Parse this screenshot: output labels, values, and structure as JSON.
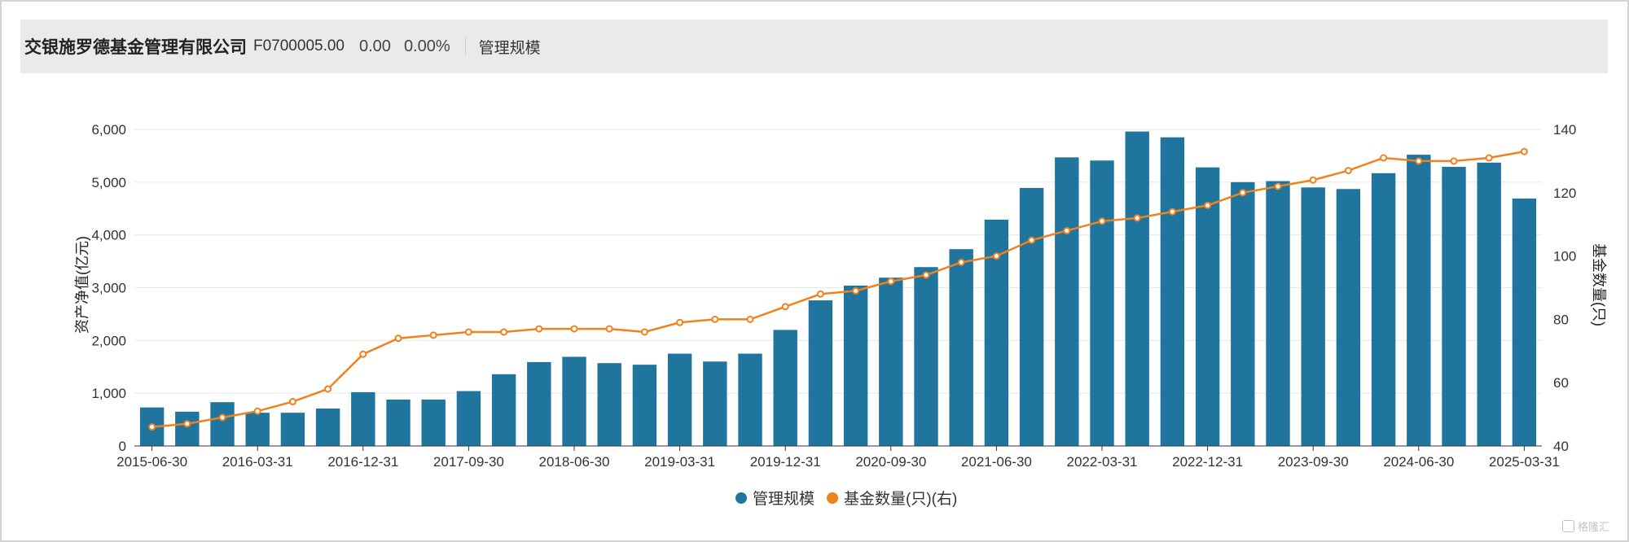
{
  "header": {
    "company": "交银施罗德基金管理有限公司",
    "code": "F0700005.00",
    "change": "0.00",
    "change_pct": "0.00%",
    "tab": "管理规模"
  },
  "watermark": "格隆汇",
  "colors": {
    "bar": "#20759f",
    "line": "#f0821e",
    "header_bg": "#e9eaec"
  },
  "chart_data": {
    "type": "bar",
    "categories": [
      "2015-06-30",
      "2015-09-30",
      "2015-12-31",
      "2016-03-31",
      "2016-06-30",
      "2016-09-30",
      "2016-12-31",
      "2017-03-31",
      "2017-06-30",
      "2017-09-30",
      "2017-12-31",
      "2018-03-31",
      "2018-06-30",
      "2018-09-30",
      "2018-12-31",
      "2019-03-31",
      "2019-06-30",
      "2019-09-30",
      "2019-12-31",
      "2020-03-31",
      "2020-06-30",
      "2020-09-30",
      "2020-12-31",
      "2021-03-31",
      "2021-06-30",
      "2021-09-30",
      "2021-12-31",
      "2022-03-31",
      "2022-06-30",
      "2022-09-30",
      "2022-12-31",
      "2023-03-31",
      "2023-06-30",
      "2023-09-30",
      "2023-12-31",
      "2024-03-31",
      "2024-06-30",
      "2024-09-30",
      "2024-12-31",
      "2025-03-31"
    ],
    "x_tick_labels": [
      "2015-06-30",
      "2016-03-31",
      "2016-12-31",
      "2017-09-30",
      "2018-06-30",
      "2019-03-31",
      "2019-12-31",
      "2020-09-30",
      "2021-06-30",
      "2022-03-31",
      "2022-12-31",
      "2023-09-30",
      "2024-06-30",
      "2025-03-31"
    ],
    "series": [
      {
        "name": "管理规模",
        "type": "bar",
        "axis": "left",
        "values": [
          730,
          650,
          830,
          630,
          630,
          710,
          1020,
          880,
          880,
          1040,
          1360,
          1590,
          1690,
          1570,
          1540,
          1750,
          1600,
          1750,
          2200,
          2760,
          3040,
          3190,
          3390,
          3730,
          4290,
          4890,
          5470,
          5410,
          5960,
          5850,
          5280,
          5000,
          5020,
          4900,
          4870,
          5170,
          5520,
          5290,
          5370,
          4690
        ]
      },
      {
        "name": "基金数量(只)(右)",
        "type": "line",
        "axis": "right",
        "values": [
          46,
          47,
          49,
          51,
          54,
          58,
          69,
          74,
          75,
          76,
          76,
          77,
          77,
          77,
          76,
          79,
          80,
          80,
          84,
          88,
          89,
          92,
          94,
          98,
          100,
          105,
          108,
          111,
          112,
          114,
          116,
          120,
          122,
          124,
          127,
          131,
          130,
          130,
          131,
          133
        ]
      }
    ],
    "y_left": {
      "label": "资产净值(亿元)",
      "ylim": [
        0,
        6000
      ],
      "ticks": [
        "0",
        "1,000",
        "2,000",
        "3,000",
        "4,000",
        "5,000",
        "6,000"
      ]
    },
    "y_right": {
      "label": "基金数量(只)",
      "ylim": [
        40,
        140
      ],
      "ticks": [
        "40",
        "60",
        "80",
        "100",
        "120",
        "140"
      ]
    },
    "legend": {
      "position": "bottom",
      "items": [
        "管理规模",
        "基金数量(只)(右)"
      ]
    },
    "grid": true
  }
}
